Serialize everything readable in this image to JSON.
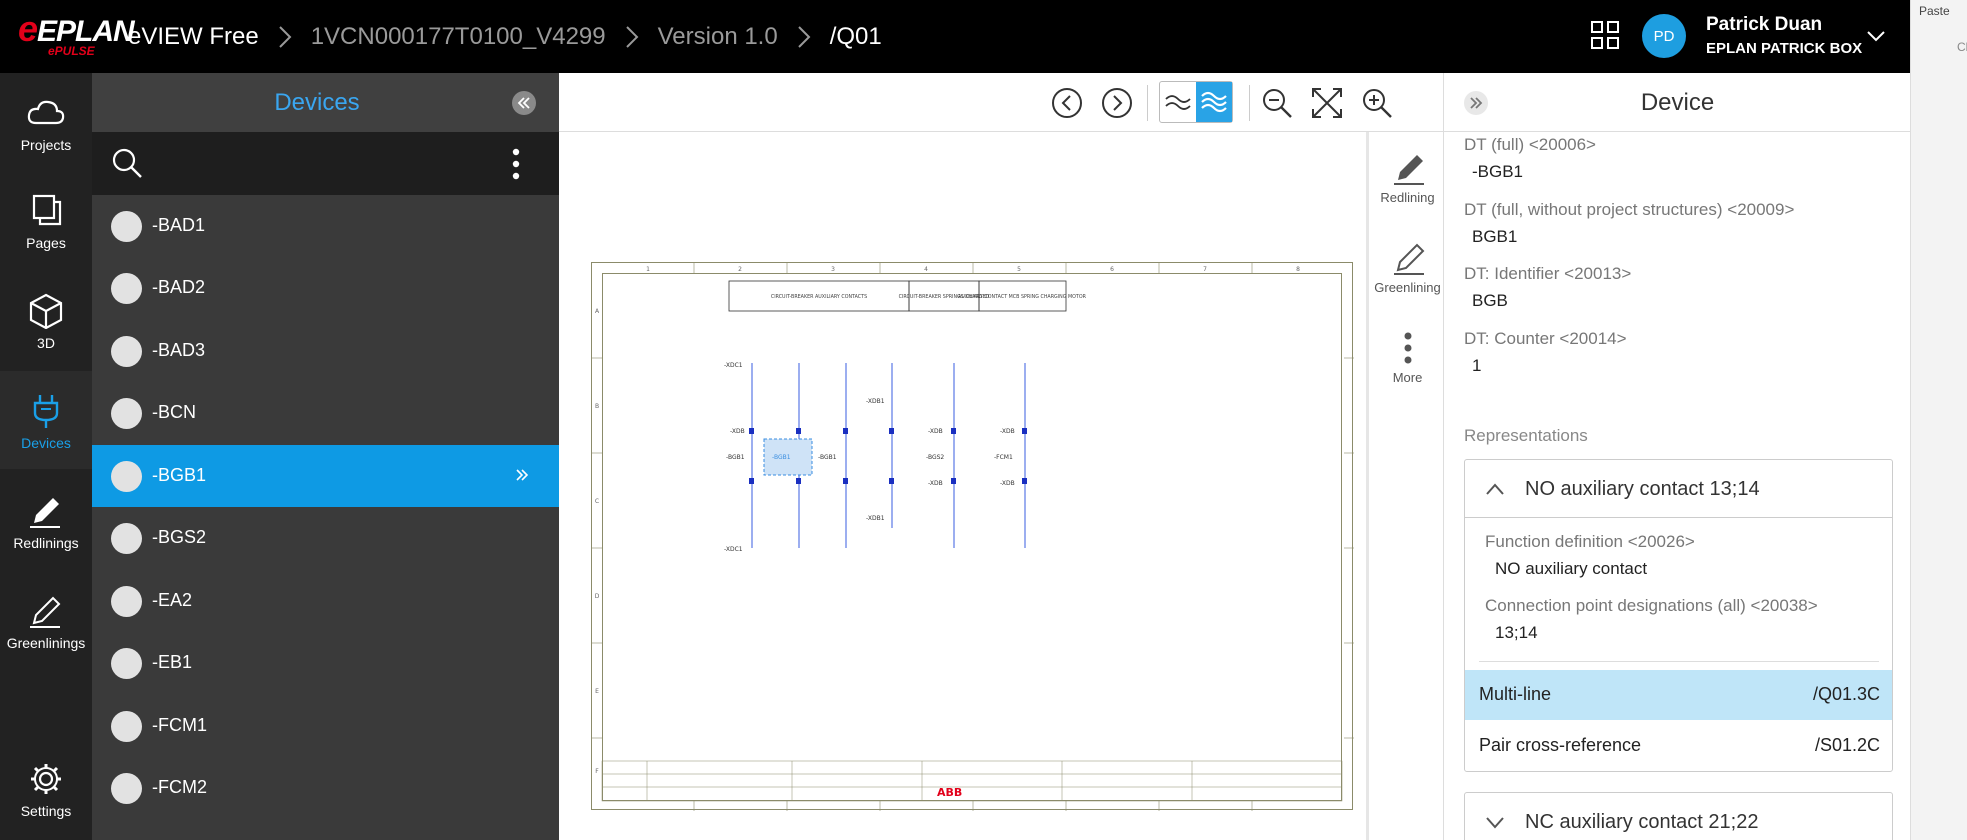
{
  "topbar": {
    "logo_text": "EPLAN",
    "logo_sub": "ePULSE",
    "app_name": "eVIEW Free",
    "breadcrumbs": [
      "1VCN000177T0100_V4299",
      "Version 1.0",
      "/Q01"
    ],
    "user_initials": "PD",
    "user_name": "Patrick Duan",
    "user_org": "EPLAN PATRICK BOX"
  },
  "office_strip": {
    "paste": "Paste",
    "cli": "Cli"
  },
  "rail": {
    "items": [
      {
        "label": "Projects",
        "icon": "cloud-icon"
      },
      {
        "label": "Pages",
        "icon": "pages-icon"
      },
      {
        "label": "3D",
        "icon": "cube-icon"
      },
      {
        "label": "Devices",
        "icon": "plug-icon"
      },
      {
        "label": "Redlinings",
        "icon": "pen-icon"
      },
      {
        "label": "Greenlinings",
        "icon": "pen-outline-icon"
      },
      {
        "label": "Settings",
        "icon": "gear-icon"
      }
    ],
    "active": "Devices"
  },
  "devices_panel": {
    "title": "Devices",
    "items": [
      "-BAD1",
      "-BAD2",
      "-BAD3",
      "-BCN",
      "-BGB1",
      "-BGS2",
      "-EA2",
      "-EB1",
      "-FCM1",
      "-FCM2"
    ],
    "selected": "-BGB1"
  },
  "side_tools": {
    "redlining": "Redlining",
    "greenlining": "Greenlining",
    "more": "More"
  },
  "device_panel": {
    "title": "Device",
    "props": [
      {
        "label": "DT (full) <20006>",
        "value": "-BGB1"
      },
      {
        "label": "DT (full, without project structures) <20009>",
        "value": "BGB1"
      },
      {
        "label": "DT: Identifier <20013>",
        "value": "BGB"
      },
      {
        "label": "DT: Counter <20014>",
        "value": "1"
      }
    ],
    "representations_title": "Representations",
    "card1": {
      "title": "NO auxiliary contact 13;14",
      "props": [
        {
          "label": "Function definition <20026>",
          "value": "NO auxiliary contact"
        },
        {
          "label": "Connection point designations (all) <20038>",
          "value": "13;14"
        }
      ],
      "rows": [
        {
          "label": "Multi-line",
          "value": "/Q01.3C"
        },
        {
          "label": "Pair cross-reference",
          "value": "/S01.2C"
        }
      ]
    },
    "card2": {
      "title": "NC auxiliary contact 21;22"
    }
  },
  "drawing": {
    "title_boxes": [
      "CIRCUIT-BREAKER AUXILIARY CONTACTS",
      "CIRCUIT-BREAKER SPRINGS CHARGED",
      "AUXILIARY CONTACT MCB SPRING CHARGING MOTOR"
    ],
    "col_numbers": [
      "1",
      "2",
      "3",
      "4",
      "5",
      "6",
      "7",
      "8"
    ],
    "row_letters": [
      "A",
      "B",
      "C",
      "D",
      "E",
      "F"
    ],
    "tags": [
      "-XDC1",
      "-XDB",
      "-BGB1",
      "-BGB1",
      "-BGB1",
      "-XDB1",
      "-XDB1",
      "-XDB",
      "-BGS2",
      "-XDB",
      "-XDB",
      "-FCM1",
      "-XDB",
      "-XDC1"
    ],
    "brand": "ABB"
  }
}
